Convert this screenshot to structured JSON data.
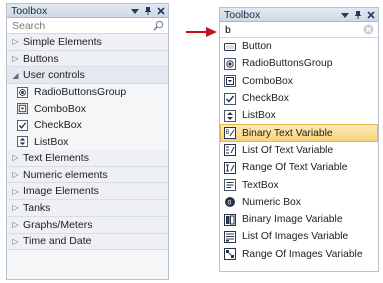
{
  "left_panel": {
    "title": "Toolbox",
    "search_placeholder": "Search",
    "groups": [
      {
        "label": "Simple Elements",
        "expanded": false
      },
      {
        "label": "Buttons",
        "expanded": false
      },
      {
        "label": "User controls",
        "expanded": true
      },
      {
        "label": "Text Elements",
        "expanded": false
      },
      {
        "label": "Numeric elements",
        "expanded": false
      },
      {
        "label": "Image Elements",
        "expanded": false
      },
      {
        "label": "Tanks",
        "expanded": false
      },
      {
        "label": "Graphs/Meters",
        "expanded": false
      },
      {
        "label": "Time and Date",
        "expanded": false
      }
    ],
    "user_controls_items": [
      {
        "label": "RadioButtonsGroup",
        "icon": "radio-group-icon"
      },
      {
        "label": "ComboBox",
        "icon": "combobox-icon"
      },
      {
        "label": "CheckBox",
        "icon": "checkbox-icon"
      },
      {
        "label": "ListBox",
        "icon": "listbox-icon"
      }
    ]
  },
  "right_panel": {
    "title": "Toolbox",
    "search_value": "b",
    "selected_index": 5,
    "items": [
      {
        "label": "Button",
        "icon": "button-icon"
      },
      {
        "label": "RadioButtonsGroup",
        "icon": "radio-group-icon"
      },
      {
        "label": "ComboBox",
        "icon": "combobox-icon"
      },
      {
        "label": "CheckBox",
        "icon": "checkbox-icon"
      },
      {
        "label": "ListBox",
        "icon": "listbox-icon"
      },
      {
        "label": "Binary Text Variable",
        "icon": "binary-text-icon"
      },
      {
        "label": "List Of Text Variable",
        "icon": "list-text-icon"
      },
      {
        "label": "Range Of Text Variable",
        "icon": "range-text-icon"
      },
      {
        "label": "TextBox",
        "icon": "textbox-icon"
      },
      {
        "label": "Numeric Box",
        "icon": "numeric-box-icon"
      },
      {
        "label": "Binary Image Variable",
        "icon": "binary-image-icon"
      },
      {
        "label": "List Of Images Variable",
        "icon": "list-images-icon"
      },
      {
        "label": "Range Of Images Variable",
        "icon": "range-images-icon"
      }
    ]
  },
  "colors": {
    "arrow": "#c0141c",
    "selection": "#f8d37a"
  }
}
